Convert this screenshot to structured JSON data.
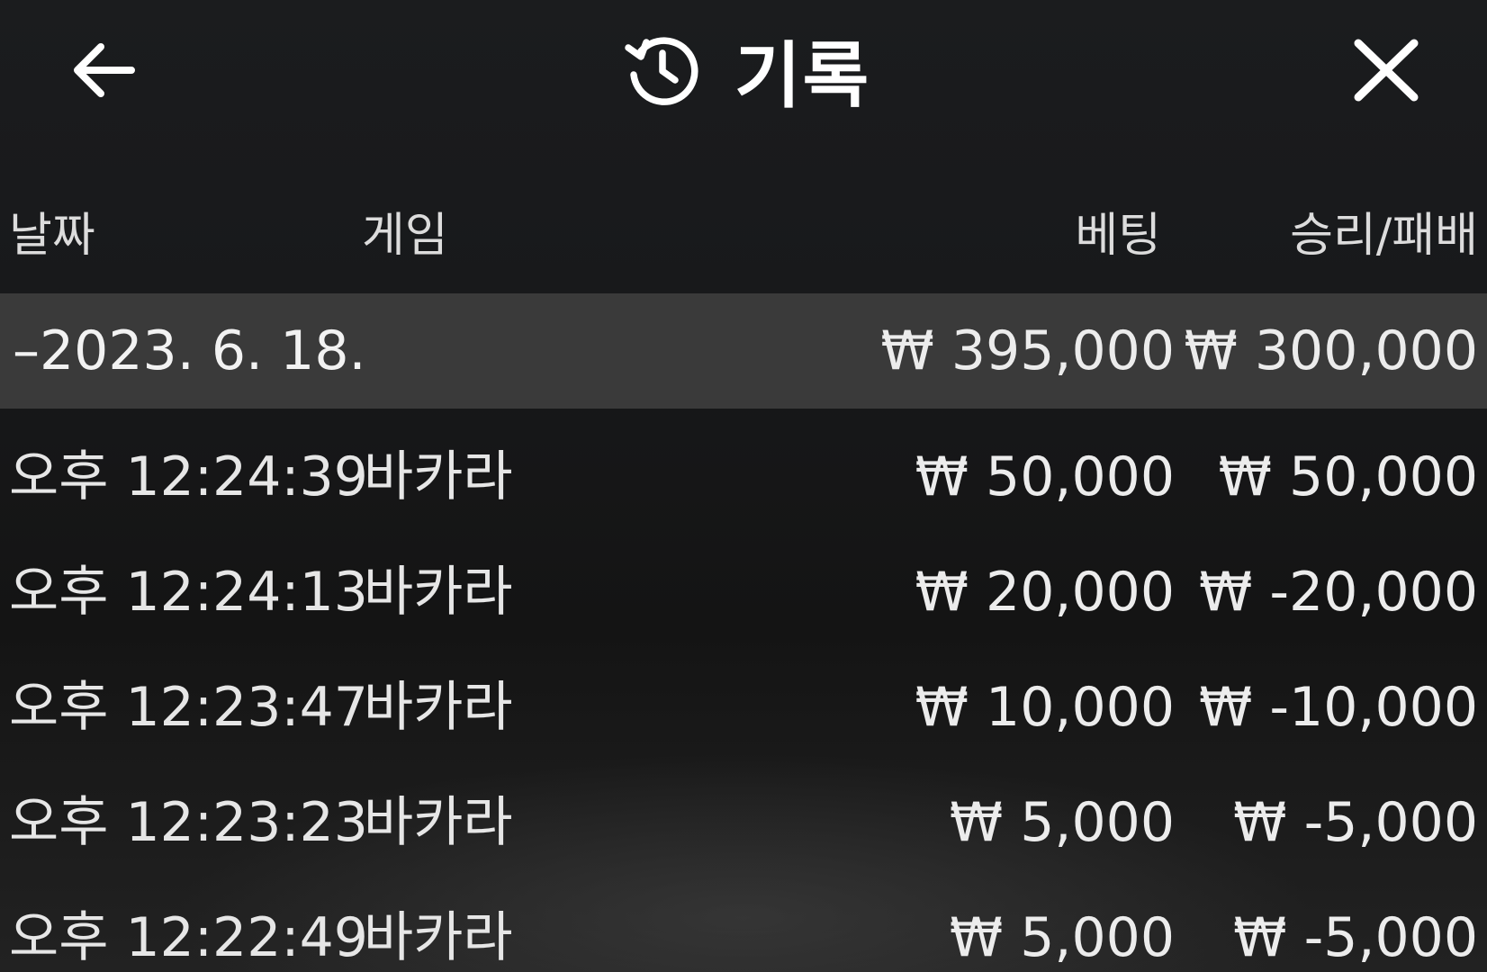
{
  "header": {
    "title": "기록",
    "back_icon": "arrow-left-icon",
    "history_icon": "history-icon",
    "close_icon": "close-icon"
  },
  "columns": {
    "date": "날짜",
    "game": "게임",
    "bet": "베팅",
    "result": "승리/패배"
  },
  "summary": {
    "date": "–2023. 6. 18.",
    "bet": "₩ 395,000",
    "result": "₩ 300,000"
  },
  "rows": [
    {
      "time": "오후 12:24:39",
      "game": "바카라",
      "bet": "₩ 50,000",
      "result": "₩ 50,000"
    },
    {
      "time": "오후 12:24:13",
      "game": "바카라",
      "bet": "₩ 20,000",
      "result": "₩ -20,000"
    },
    {
      "time": "오후 12:23:47",
      "game": "바카라",
      "bet": "₩ 10,000",
      "result": "₩ -10,000"
    },
    {
      "time": "오후 12:23:23",
      "game": "바카라",
      "bet": "₩ 5,000",
      "result": "₩ -5,000"
    },
    {
      "time": "오후 12:22:49",
      "game": "바카라",
      "bet": "₩ 5,000",
      "result": "₩ -5,000"
    }
  ]
}
